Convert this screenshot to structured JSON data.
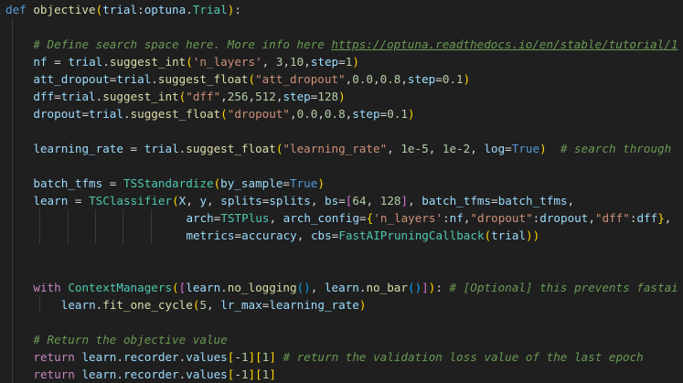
{
  "editor": {
    "language": "python",
    "code_lines": [
      "def objective(trial:optuna.Trial):",
      "",
      "    # Define search space here. More info here https://optuna.readthedocs.io/en/stable/tutorial/1",
      "    nf = trial.suggest_int('n_layers', 3,10,step=1)",
      "    att_dropout=trial.suggest_float(\"att_dropout\",0.0,0.8,step=0.1)",
      "    dff=trial.suggest_int(\"dff\",256,512,step=128)",
      "    dropout=trial.suggest_float(\"dropout\",0.0,0.8,step=0.1)",
      "",
      "    learning_rate = trial.suggest_float(\"learning_rate\", 1e-5, 1e-2, log=True)  # search through",
      "",
      "    batch_tfms = TSStandardize(by_sample=True)",
      "    learn = TSClassifier(X, y, splits=splits, bs=[64, 128], batch_tfms=batch_tfms,",
      "                          arch=TSTPlus, arch_config={'n_layers':nf,\"dropout\":dropout,\"dff\":dff},",
      "                          metrics=accuracy, cbs=FastAIPruningCallback(trial))",
      "",
      "",
      "    with ContextManagers([learn.no_logging(), learn.no_bar()]): # [Optional] this prevents fastai",
      "        learn.fit_one_cycle(5, lr_max=learning_rate)",
      "",
      "    # Return the objective value",
      "    return learn.recorder.values[-1][1] # return the validation loss value of the last epoch",
      "    return learn.recorder.values[-1][1]"
    ],
    "colors": {
      "background": "#1f1f1f",
      "keyword": "#569cd6",
      "control_keyword": "#c586c0",
      "function": "#dcdcaa",
      "class": "#4ec9b0",
      "variable": "#9cdcfe",
      "string": "#ce9178",
      "number": "#b5cea8",
      "comment": "#6a9955"
    }
  }
}
